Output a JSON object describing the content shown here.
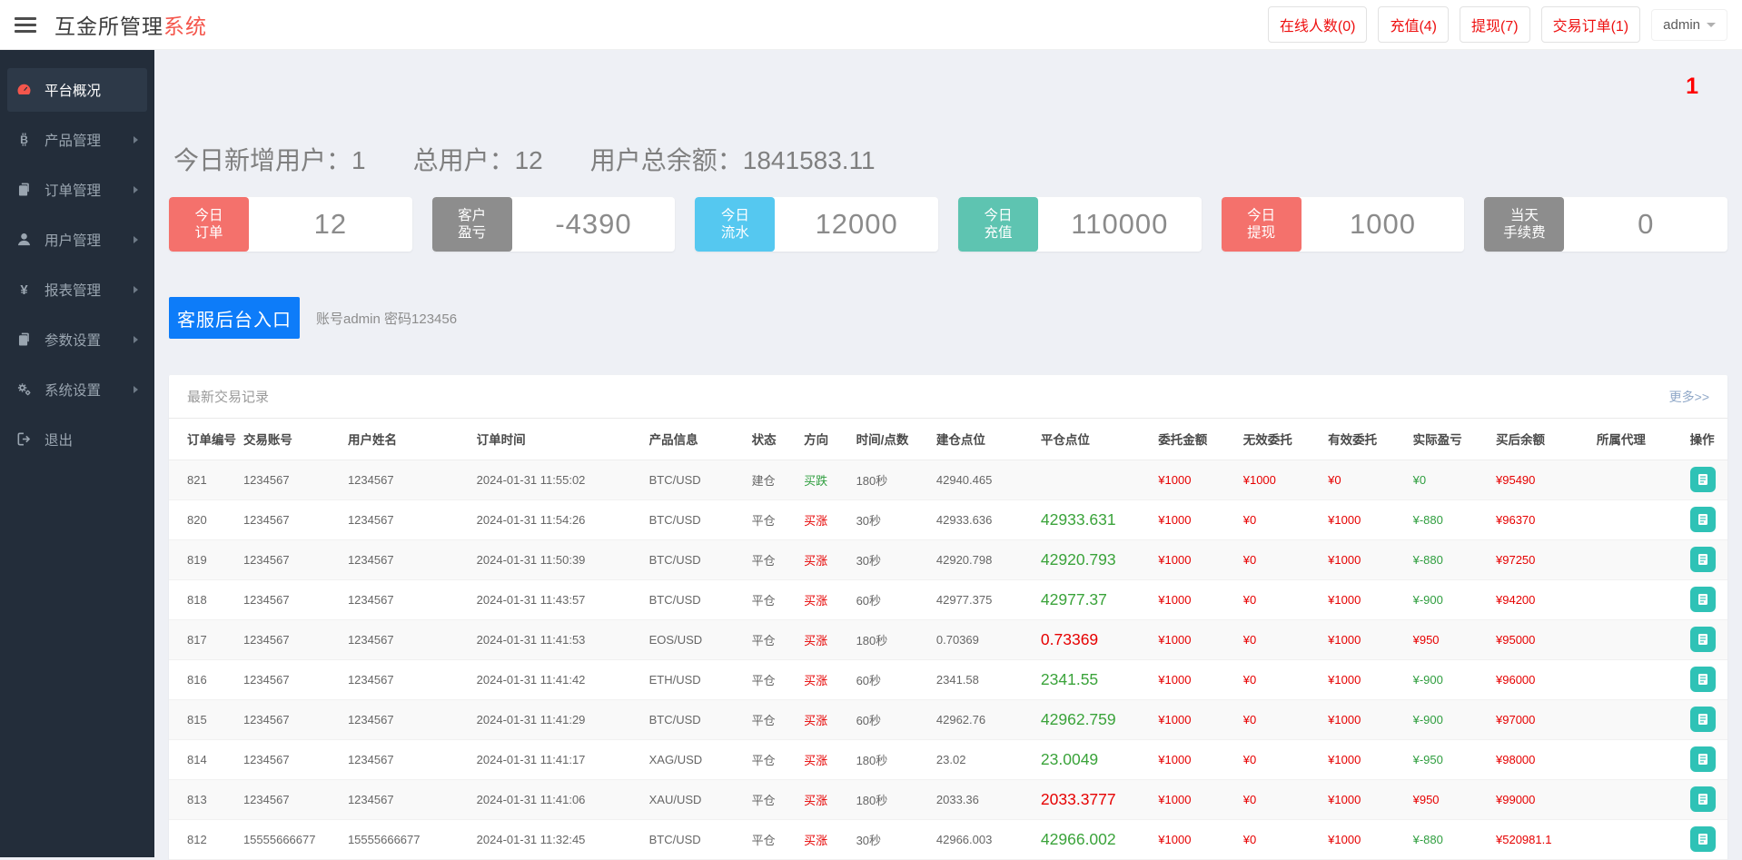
{
  "header": {
    "title_main": "互金所管理",
    "title_accent": "系统",
    "stat_buttons": [
      {
        "label": "在线人数(0)"
      },
      {
        "label": "充值(4)"
      },
      {
        "label": "提现(7)"
      },
      {
        "label": "交易订单(1)"
      }
    ],
    "user_menu": "admin"
  },
  "sidebar": {
    "items": [
      {
        "label": "平台概况",
        "icon": "dashboard-icon",
        "active": true,
        "expandable": false
      },
      {
        "label": "产品管理",
        "icon": "bitcoin-icon",
        "active": false,
        "expandable": true
      },
      {
        "label": "订单管理",
        "icon": "orders-icon",
        "active": false,
        "expandable": true
      },
      {
        "label": "用户管理",
        "icon": "user-icon",
        "active": false,
        "expandable": true
      },
      {
        "label": "报表管理",
        "icon": "yen-icon",
        "active": false,
        "expandable": true
      },
      {
        "label": "参数设置",
        "icon": "params-icon",
        "active": false,
        "expandable": true
      },
      {
        "label": "系统设置",
        "icon": "gears-icon",
        "active": false,
        "expandable": true
      },
      {
        "label": "退出",
        "icon": "logout-icon",
        "active": false,
        "expandable": false
      }
    ]
  },
  "overview": {
    "notification_badge": "1",
    "summary": [
      {
        "label": "今日新增用户：",
        "value": "1"
      },
      {
        "label": "总用户：",
        "value": "12"
      },
      {
        "label": "用户总余额：",
        "value": "1841583.11"
      }
    ],
    "stat_cards": [
      {
        "line1": "今日",
        "line2": "订单",
        "value": "12",
        "color": "#f4716c"
      },
      {
        "line1": "客户",
        "line2": "盈亏",
        "value": "-4390",
        "color": "#8d8d8d"
      },
      {
        "line1": "今日",
        "line2": "流水",
        "value": "12000",
        "color": "#55c8f0"
      },
      {
        "line1": "今日",
        "line2": "充值",
        "value": "110000",
        "color": "#5ec4b1"
      },
      {
        "line1": "今日",
        "line2": "提现",
        "value": "1000",
        "color": "#f4716c"
      },
      {
        "line1": "当天",
        "line2": "手续费",
        "value": "0",
        "color": "#8d8d8d"
      }
    ],
    "service_button": "客服后台入口",
    "service_hint": "账号admin 密码123456"
  },
  "panel": {
    "title": "最新交易记录",
    "more_link": "更多>>",
    "columns": [
      "订单编号",
      "交易账号",
      "用户姓名",
      "订单时间",
      "产品信息",
      "状态",
      "方向",
      "时间/点数",
      "建仓点位",
      "平仓点位",
      "委托金额",
      "无效委托",
      "有效委托",
      "实际盈亏",
      "买后余额",
      "所属代理",
      "操作"
    ],
    "rows": [
      {
        "id": "821",
        "account": "1234567",
        "name": "1234567",
        "time": "2024-01-31 11:55:02",
        "product": "BTC/USD",
        "status": "建仓",
        "direction": "买跌",
        "direction_color": "green",
        "duration": "180秒",
        "open_price": "42940.465",
        "close_price": "",
        "close_color": "green",
        "amount": "¥1000",
        "invalid": "¥1000",
        "valid": "¥0",
        "profit": "¥0",
        "profit_color": "green",
        "balance": "¥95490",
        "agent": ""
      },
      {
        "id": "820",
        "account": "1234567",
        "name": "1234567",
        "time": "2024-01-31 11:54:26",
        "product": "BTC/USD",
        "status": "平仓",
        "direction": "买涨",
        "direction_color": "red",
        "duration": "30秒",
        "open_price": "42933.636",
        "close_price": "42933.631",
        "close_color": "green",
        "amount": "¥1000",
        "invalid": "¥0",
        "valid": "¥1000",
        "profit": "¥-880",
        "profit_color": "green",
        "balance": "¥96370",
        "agent": ""
      },
      {
        "id": "819",
        "account": "1234567",
        "name": "1234567",
        "time": "2024-01-31 11:50:39",
        "product": "BTC/USD",
        "status": "平仓",
        "direction": "买涨",
        "direction_color": "red",
        "duration": "30秒",
        "open_price": "42920.798",
        "close_price": "42920.793",
        "close_color": "green",
        "amount": "¥1000",
        "invalid": "¥0",
        "valid": "¥1000",
        "profit": "¥-880",
        "profit_color": "green",
        "balance": "¥97250",
        "agent": ""
      },
      {
        "id": "818",
        "account": "1234567",
        "name": "1234567",
        "time": "2024-01-31 11:43:57",
        "product": "BTC/USD",
        "status": "平仓",
        "direction": "买涨",
        "direction_color": "red",
        "duration": "60秒",
        "open_price": "42977.375",
        "close_price": "42977.37",
        "close_color": "green",
        "amount": "¥1000",
        "invalid": "¥0",
        "valid": "¥1000",
        "profit": "¥-900",
        "profit_color": "green",
        "balance": "¥94200",
        "agent": ""
      },
      {
        "id": "817",
        "account": "1234567",
        "name": "1234567",
        "time": "2024-01-31 11:41:53",
        "product": "EOS/USD",
        "status": "平仓",
        "direction": "买涨",
        "direction_color": "red",
        "duration": "180秒",
        "open_price": "0.70369",
        "close_price": "0.73369",
        "close_color": "red",
        "amount": "¥1000",
        "invalid": "¥0",
        "valid": "¥1000",
        "profit": "¥950",
        "profit_color": "red",
        "balance": "¥95000",
        "agent": ""
      },
      {
        "id": "816",
        "account": "1234567",
        "name": "1234567",
        "time": "2024-01-31 11:41:42",
        "product": "ETH/USD",
        "status": "平仓",
        "direction": "买涨",
        "direction_color": "red",
        "duration": "60秒",
        "open_price": "2341.58",
        "close_price": "2341.55",
        "close_color": "green",
        "amount": "¥1000",
        "invalid": "¥0",
        "valid": "¥1000",
        "profit": "¥-900",
        "profit_color": "green",
        "balance": "¥96000",
        "agent": ""
      },
      {
        "id": "815",
        "account": "1234567",
        "name": "1234567",
        "time": "2024-01-31 11:41:29",
        "product": "BTC/USD",
        "status": "平仓",
        "direction": "买涨",
        "direction_color": "red",
        "duration": "60秒",
        "open_price": "42962.76",
        "close_price": "42962.759",
        "close_color": "green",
        "amount": "¥1000",
        "invalid": "¥0",
        "valid": "¥1000",
        "profit": "¥-900",
        "profit_color": "green",
        "balance": "¥97000",
        "agent": ""
      },
      {
        "id": "814",
        "account": "1234567",
        "name": "1234567",
        "time": "2024-01-31 11:41:17",
        "product": "XAG/USD",
        "status": "平仓",
        "direction": "买涨",
        "direction_color": "red",
        "duration": "180秒",
        "open_price": "23.02",
        "close_price": "23.0049",
        "close_color": "green",
        "amount": "¥1000",
        "invalid": "¥0",
        "valid": "¥1000",
        "profit": "¥-950",
        "profit_color": "green",
        "balance": "¥98000",
        "agent": ""
      },
      {
        "id": "813",
        "account": "1234567",
        "name": "1234567",
        "time": "2024-01-31 11:41:06",
        "product": "XAU/USD",
        "status": "平仓",
        "direction": "买涨",
        "direction_color": "red",
        "duration": "180秒",
        "open_price": "2033.36",
        "close_price": "2033.3777",
        "close_color": "red",
        "amount": "¥1000",
        "invalid": "¥0",
        "valid": "¥1000",
        "profit": "¥950",
        "profit_color": "red",
        "balance": "¥99000",
        "agent": ""
      },
      {
        "id": "812",
        "account": "15555666677",
        "name": "15555666677",
        "time": "2024-01-31 11:32:45",
        "product": "BTC/USD",
        "status": "平仓",
        "direction": "买涨",
        "direction_color": "red",
        "duration": "30秒",
        "open_price": "42966.003",
        "close_price": "42966.002",
        "close_color": "green",
        "amount": "¥1000",
        "invalid": "¥0",
        "valid": "¥1000",
        "profit": "¥-880",
        "profit_color": "green",
        "balance": "¥520981.1",
        "agent": ""
      }
    ]
  },
  "theme": {
    "accent_red": "#e60000",
    "up_green": "#2f9e3f",
    "primary_blue": "#0d7cf9",
    "action_teal": "#2fc2b6",
    "sidebar_bg": "#232d3a",
    "page_bg": "#eef0f5"
  }
}
